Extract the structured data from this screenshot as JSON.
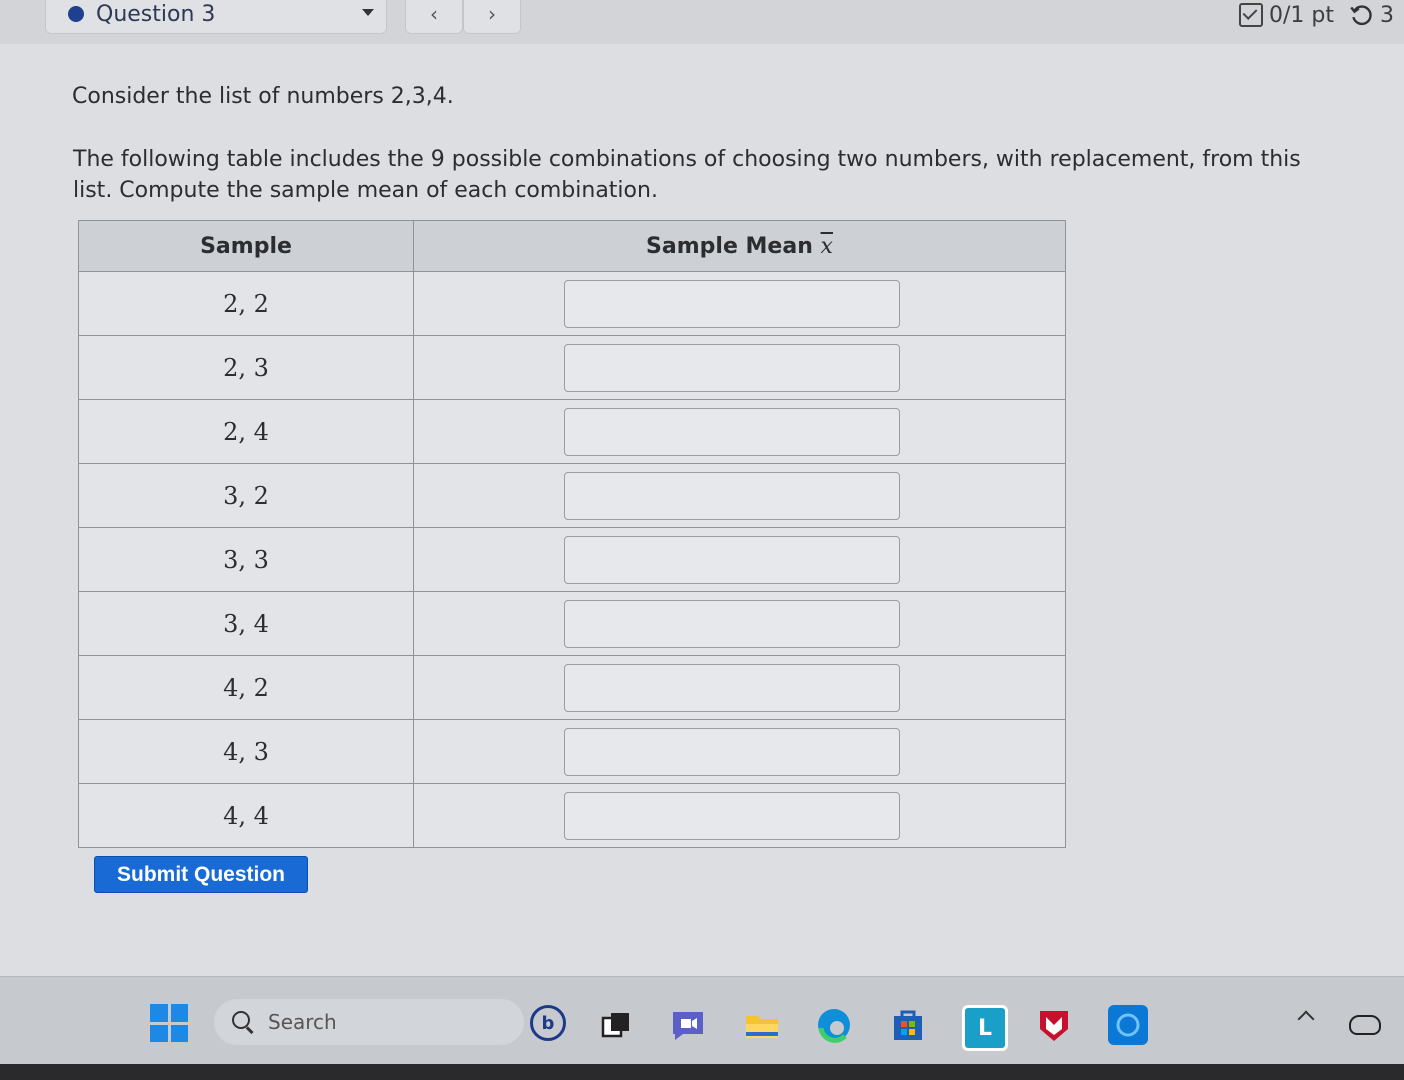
{
  "header": {
    "question_label": "Question 3",
    "prev_glyph": "‹",
    "next_glyph": "›",
    "points": "0/1 pt",
    "retries": "3"
  },
  "prompt": {
    "line1": "Consider the list of numbers 2,3,4.",
    "line2": "The following table includes the 9 possible combinations of choosing two numbers, with replacement, from this list. Compute the sample mean of each combination."
  },
  "table": {
    "col_sample": "Sample",
    "col_mean_prefix": "Sample Mean",
    "col_mean_symbol": "x",
    "rows": [
      {
        "sample": "2, 2",
        "mean": ""
      },
      {
        "sample": "2, 3",
        "mean": ""
      },
      {
        "sample": "2, 4",
        "mean": ""
      },
      {
        "sample": "3, 2",
        "mean": ""
      },
      {
        "sample": "3, 3",
        "mean": ""
      },
      {
        "sample": "3, 4",
        "mean": ""
      },
      {
        "sample": "4, 2",
        "mean": ""
      },
      {
        "sample": "4, 3",
        "mean": ""
      },
      {
        "sample": "4, 4",
        "mean": ""
      }
    ]
  },
  "submit_label": "Submit Question",
  "taskbar": {
    "search_label": "Search",
    "icons": [
      "windows-start-icon",
      "search-icon",
      "bing-icon",
      "task-view-icon",
      "chat-icon",
      "file-explorer-icon",
      "edge-icon",
      "microsoft-store-icon",
      "lexia-icon",
      "mcafee-icon",
      "cortana-icon"
    ]
  },
  "colors": {
    "submit_bg": "#1a6ad6",
    "accent_blue": "#1e88e5"
  }
}
